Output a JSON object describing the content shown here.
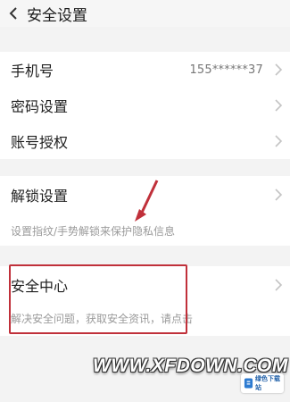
{
  "header": {
    "title": "安全设置"
  },
  "account_group": [
    {
      "label": "手机号",
      "value": "155******37"
    },
    {
      "label": "密码设置"
    },
    {
      "label": "账号授权"
    }
  ],
  "unlock": {
    "label": "解锁设置",
    "description": "设置指纹/手势解锁来保护隐私信息"
  },
  "security_center": {
    "label": "安全中心",
    "description": "解决安全问题，获取安全资讯，请点击"
  },
  "watermark": {
    "text": "WWW.XFDOWN.COM",
    "logo_text": "绿色下载站"
  },
  "colors": {
    "annotation": "#c0303a",
    "background": "#f3f3f3",
    "card": "#ffffff"
  }
}
